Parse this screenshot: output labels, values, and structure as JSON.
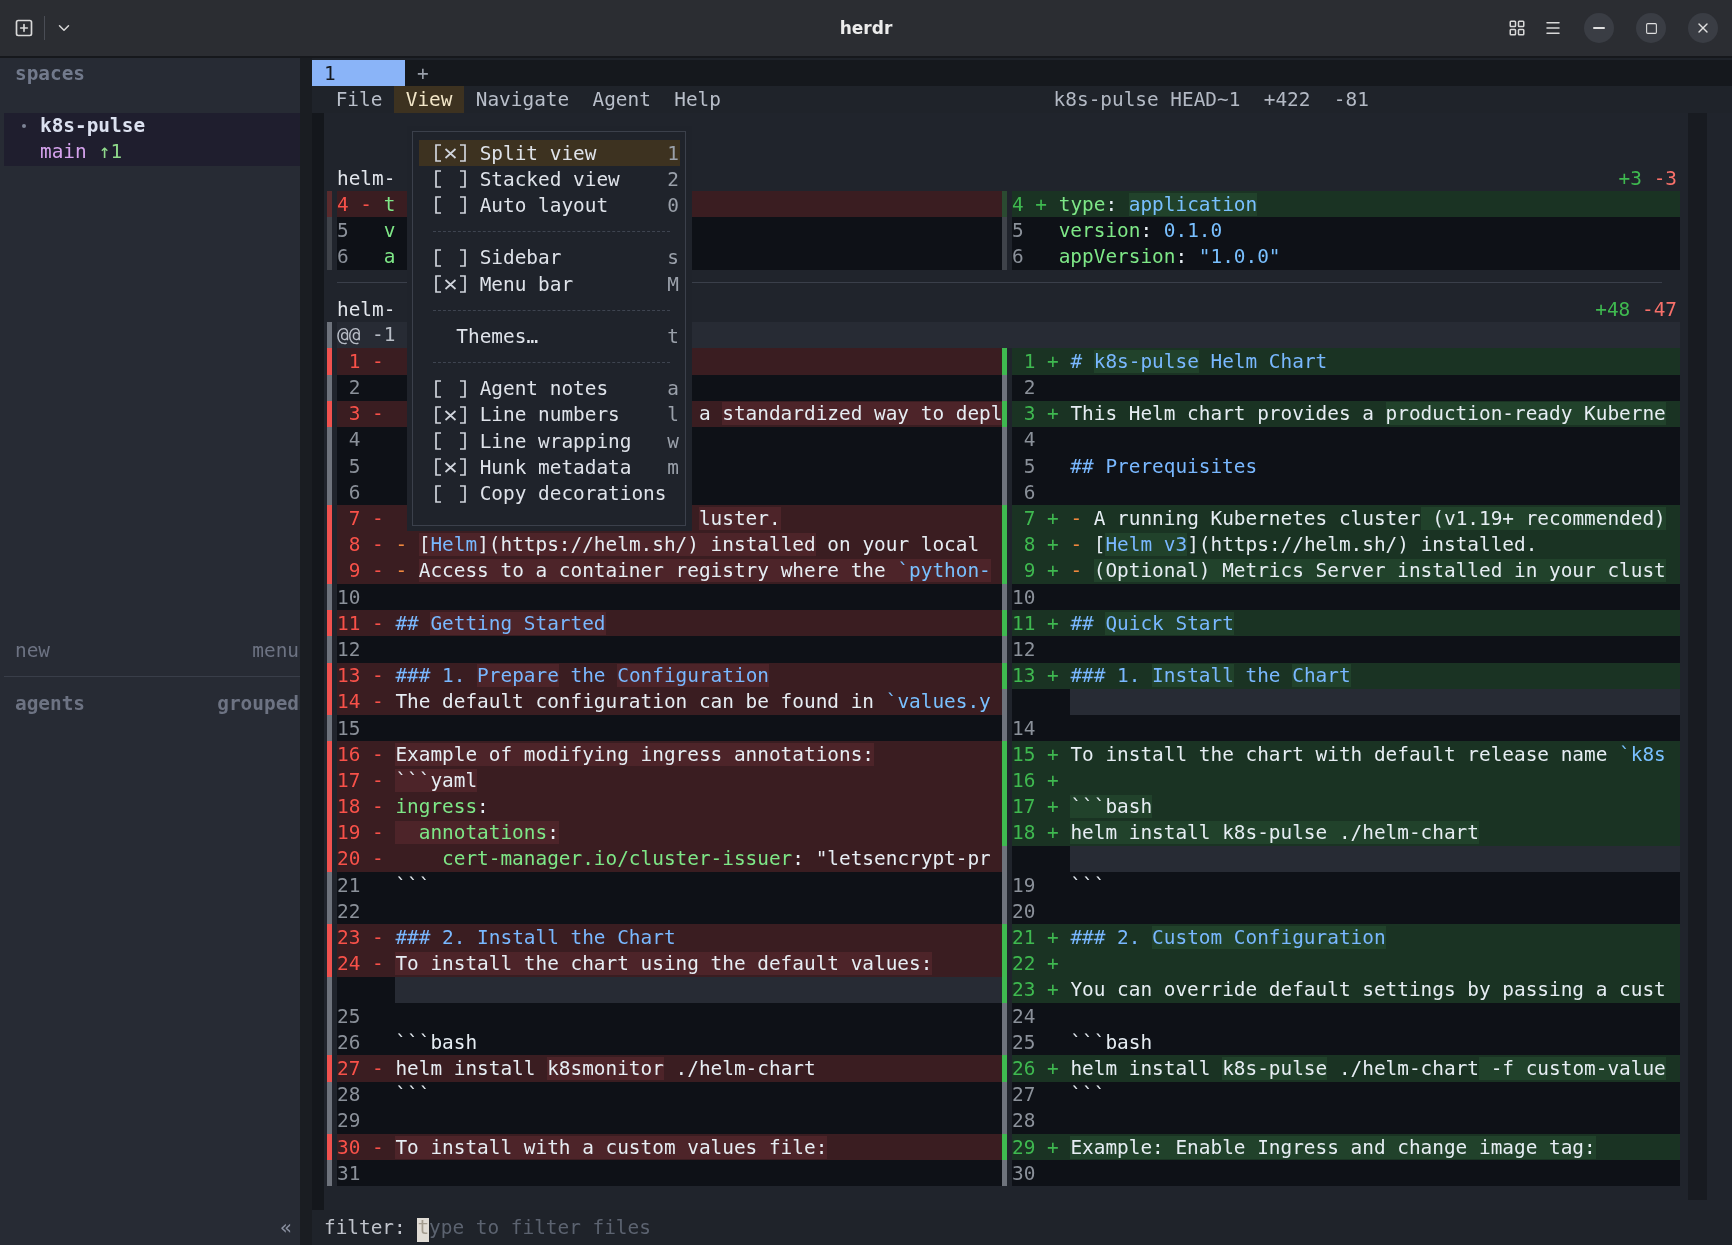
{
  "window": {
    "title": "herdr"
  },
  "sidebar": {
    "heading": "spaces",
    "workspaces": [
      {
        "name": "k8s-pulse",
        "branch": "main",
        "ahead": "↑1",
        "selected": true
      }
    ],
    "new_label": "new",
    "menu_label": "menu",
    "agents_heading": "agents",
    "agents_mode": "grouped",
    "collapse": "«"
  },
  "tabs": [
    {
      "label": "1",
      "selected": true
    }
  ],
  "add_tab": "+",
  "menu_bar": {
    "items": [
      {
        "label": "File",
        "selected": false
      },
      {
        "label": "View",
        "selected": true
      },
      {
        "label": "Navigate",
        "selected": false
      },
      {
        "label": "Agent",
        "selected": false
      },
      {
        "label": "Help",
        "selected": false
      }
    ],
    "status": {
      "ref": "k8s-pulse HEAD~1",
      "added": "+422",
      "removed": "-81"
    }
  },
  "view_menu": [
    {
      "kind": "toggle",
      "checked": true,
      "label": "Split view",
      "key": "1",
      "selected": true
    },
    {
      "kind": "toggle",
      "checked": false,
      "label": "Stacked view",
      "key": "2",
      "selected": false
    },
    {
      "kind": "toggle",
      "checked": false,
      "label": "Auto layout",
      "key": "0",
      "selected": false
    },
    {
      "kind": "separator"
    },
    {
      "kind": "toggle",
      "checked": false,
      "label": "Sidebar",
      "key": "s",
      "selected": false
    },
    {
      "kind": "toggle",
      "checked": true,
      "label": "Menu bar",
      "key": "M",
      "selected": false
    },
    {
      "kind": "separator"
    },
    {
      "kind": "action",
      "label": "Themes…",
      "key": "t",
      "selected": false
    },
    {
      "kind": "separator"
    },
    {
      "kind": "toggle",
      "checked": false,
      "label": "Agent notes",
      "key": "a",
      "selected": false
    },
    {
      "kind": "toggle",
      "checked": true,
      "label": "Line numbers",
      "key": "l",
      "selected": false
    },
    {
      "kind": "toggle",
      "checked": false,
      "label": "Line wrapping",
      "key": "w",
      "selected": false
    },
    {
      "kind": "toggle",
      "checked": true,
      "label": "Hunk metadata",
      "key": "m",
      "selected": false
    },
    {
      "kind": "toggle",
      "checked": false,
      "label": "Copy decorations",
      "selected": false
    }
  ],
  "diff": {
    "files": [
      {
        "name": "helm-",
        "added": "+3",
        "removed": "-3",
        "focused": false,
        "rows": [
          {
            "left": {
              "kind": "removed",
              "number": "4",
              "sign": "-",
              "segments": [
                {
                  "text": "t",
                  "kind": "key",
                  "highlight": false
                }
              ]
            },
            "right": {
              "kind": "added",
              "number": "4",
              "sign": "+",
              "segments": [
                {
                  "text": "type",
                  "kind": "key",
                  "highlight": false
                },
                {
                  "text": ": ",
                  "kind": "plain",
                  "highlight": false
                },
                {
                  "text": "application",
                  "kind": "value",
                  "highlight": true
                }
              ]
            }
          },
          {
            "left": {
              "kind": "context",
              "number": "5",
              "segments": [
                {
                  "text": "v",
                  "kind": "key",
                  "highlight": false
                }
              ]
            },
            "right": {
              "kind": "context",
              "number": "5",
              "segments": [
                {
                  "text": "version",
                  "kind": "key",
                  "highlight": false
                },
                {
                  "text": ": ",
                  "kind": "plain",
                  "highlight": false
                },
                {
                  "text": "0.1.0",
                  "kind": "value",
                  "highlight": false
                }
              ]
            }
          },
          {
            "left": {
              "kind": "context",
              "number": "6",
              "segments": [
                {
                  "text": "a",
                  "kind": "key",
                  "highlight": false
                }
              ]
            },
            "right": {
              "kind": "context",
              "number": "6",
              "segments": [
                {
                  "text": "appVersion",
                  "kind": "key",
                  "highlight": false
                },
                {
                  "text": ": ",
                  "kind": "plain",
                  "highlight": false
                },
                {
                  "text": "\"1.0.0\"",
                  "kind": "value",
                  "highlight": false
                }
              ]
            }
          }
        ]
      },
      {
        "name": "helm-",
        "added": "+48",
        "removed": "-47",
        "focused": true,
        "hunk": "@@ -1",
        "rows": [
          {
            "left": {
              "kind": "removed",
              "number": "1",
              "sign": "-"
            },
            "right": {
              "kind": "added",
              "number": "1",
              "sign": "+",
              "segments": [
                {
                  "text": "# ",
                  "kind": "heading",
                  "highlight": false
                },
                {
                  "text": "k8s-pulse",
                  "kind": "heading",
                  "highlight": true
                },
                {
                  "text": " Helm Chart",
                  "kind": "heading",
                  "highlight": false
                }
              ]
            }
          },
          {
            "left": {
              "kind": "context",
              "number": "2"
            },
            "right": {
              "kind": "context",
              "number": "2"
            }
          },
          {
            "left": {
              "kind": "removed",
              "number": "3",
              "sign": "-",
              "after_menu": [
                {
                  "text": "a ",
                  "kind": "plain",
                  "highlight": false
                },
                {
                  "text": "standardized way to depl",
                  "kind": "plain",
                  "highlight": true
                }
              ]
            },
            "right": {
              "kind": "added",
              "number": "3",
              "sign": "+",
              "segments": [
                {
                  "text": "This Helm chart provides a ",
                  "kind": "plain",
                  "highlight": false
                },
                {
                  "text": "production-ready Kuberne",
                  "kind": "plain",
                  "highlight": true
                }
              ]
            }
          },
          {
            "left": {
              "kind": "context",
              "number": "4"
            },
            "right": {
              "kind": "context",
              "number": "4"
            }
          },
          {
            "left": {
              "kind": "context",
              "number": "5"
            },
            "right": {
              "kind": "context",
              "number": "5",
              "segments": [
                {
                  "text": "## Prerequisites",
                  "kind": "heading",
                  "highlight": false
                }
              ]
            }
          },
          {
            "left": {
              "kind": "context",
              "number": "6"
            },
            "right": {
              "kind": "context",
              "number": "6"
            }
          },
          {
            "left": {
              "kind": "removed",
              "number": "7",
              "sign": "-",
              "after_menu": [
                {
                  "text": "luster.",
                  "kind": "plain",
                  "highlight": true
                }
              ]
            },
            "right": {
              "kind": "added",
              "number": "7",
              "sign": "+",
              "segments": [
                {
                  "text": "- ",
                  "kind": "bullet",
                  "highlight": false
                },
                {
                  "text": "A running Kubernetes cluster",
                  "kind": "plain",
                  "highlight": false
                },
                {
                  "text": " (v1.19+ recommended)",
                  "kind": "plain",
                  "highlight": true
                }
              ]
            }
          },
          {
            "left": {
              "kind": "removed",
              "number": "8",
              "sign": "-",
              "segments": [
                {
                  "text": "- ",
                  "kind": "bullet",
                  "highlight": false
                },
                {
                  "text": "[",
                  "kind": "plain",
                  "highlight": true
                },
                {
                  "text": "Helm",
                  "kind": "link",
                  "highlight": true
                },
                {
                  "text": "](https://helm.sh/) installed",
                  "kind": "plain",
                  "highlight": true
                },
                {
                  "text": " on your local",
                  "kind": "plain",
                  "highlight": false
                }
              ]
            },
            "right": {
              "kind": "added",
              "number": "8",
              "sign": "+",
              "segments": [
                {
                  "text": "- ",
                  "kind": "bullet",
                  "highlight": false
                },
                {
                  "text": "[",
                  "kind": "plain",
                  "highlight": false
                },
                {
                  "text": "Helm v3",
                  "kind": "link",
                  "highlight": true
                },
                {
                  "text": "](https://helm.sh/) installed.",
                  "kind": "plain",
                  "highlight": false
                }
              ]
            }
          },
          {
            "left": {
              "kind": "removed",
              "number": "9",
              "sign": "-",
              "segments": [
                {
                  "text": "- ",
                  "kind": "bullet",
                  "highlight": false
                },
                {
                  "text": "Access to a container registry where the ",
                  "kind": "plain",
                  "highlight": true
                },
                {
                  "text": "`python-",
                  "kind": "value",
                  "highlight": true
                }
              ]
            },
            "right": {
              "kind": "added",
              "number": "9",
              "sign": "+",
              "segments": [
                {
                  "text": "- ",
                  "kind": "bullet",
                  "highlight": false
                },
                {
                  "text": "(Optional) Metrics Server installed in your clust",
                  "kind": "plain",
                  "highlight": true
                }
              ]
            }
          },
          {
            "left": {
              "kind": "context",
              "number": "10"
            },
            "right": {
              "kind": "context",
              "number": "10"
            }
          },
          {
            "left": {
              "kind": "removed",
              "number": "11",
              "sign": "-",
              "segments": [
                {
                  "text": "## ",
                  "kind": "heading",
                  "highlight": false
                },
                {
                  "text": "Getting Started",
                  "kind": "heading",
                  "highlight": true
                }
              ]
            },
            "right": {
              "kind": "added",
              "number": "11",
              "sign": "+",
              "segments": [
                {
                  "text": "## ",
                  "kind": "heading",
                  "highlight": false
                },
                {
                  "text": "Quick Start",
                  "kind": "heading",
                  "highlight": true
                }
              ]
            }
          },
          {
            "left": {
              "kind": "context",
              "number": "12"
            },
            "right": {
              "kind": "context",
              "number": "12"
            }
          },
          {
            "left": {
              "kind": "removed",
              "number": "13",
              "sign": "-",
              "segments": [
                {
                  "text": "### 1. ",
                  "kind": "heading",
                  "highlight": false
                },
                {
                  "text": "Prepare",
                  "kind": "heading",
                  "highlight": true
                },
                {
                  "text": " the ",
                  "kind": "heading",
                  "highlight": false
                },
                {
                  "text": "Configuration",
                  "kind": "heading",
                  "highlight": true
                }
              ]
            },
            "right": {
              "kind": "added",
              "number": "13",
              "sign": "+",
              "segments": [
                {
                  "text": "### 1. ",
                  "kind": "heading",
                  "highlight": false
                },
                {
                  "text": "Install",
                  "kind": "heading",
                  "highlight": true
                },
                {
                  "text": " the ",
                  "kind": "heading",
                  "highlight": false
                },
                {
                  "text": "Chart",
                  "kind": "heading",
                  "highlight": true
                }
              ]
            }
          },
          {
            "left": {
              "kind": "removed",
              "number": "14",
              "sign": "-",
              "segments": [
                {
                  "text": "The default configuration can be found in ",
                  "kind": "plain",
                  "highlight": false
                },
                {
                  "text": "`values.y",
                  "kind": "value",
                  "highlight": false
                }
              ]
            },
            "right": {
              "kind": "filler"
            }
          },
          {
            "left": {
              "kind": "context",
              "number": "15"
            },
            "right": {
              "kind": "context",
              "number": "14"
            }
          },
          {
            "left": {
              "kind": "removed",
              "number": "16",
              "sign": "-",
              "segments": [
                {
                  "text": "Example of modifying ingress annotations:",
                  "kind": "plain",
                  "highlight": true
                }
              ]
            },
            "right": {
              "kind": "added",
              "number": "15",
              "sign": "+",
              "segments": [
                {
                  "text": "To install the chart with default release name ",
                  "kind": "plain",
                  "highlight": false
                },
                {
                  "text": "`k8s",
                  "kind": "value",
                  "highlight": false
                }
              ]
            }
          },
          {
            "left": {
              "kind": "removed",
              "number": "17",
              "sign": "-",
              "segments": [
                {
                  "text": "```yaml",
                  "kind": "plain",
                  "highlight": true
                }
              ]
            },
            "right": {
              "kind": "added",
              "number": "16",
              "sign": "+"
            }
          },
          {
            "left": {
              "kind": "removed",
              "number": "18",
              "sign": "-",
              "segments": [
                {
                  "text": "ingress",
                  "kind": "key",
                  "highlight": false
                },
                {
                  "text": ":",
                  "kind": "plain",
                  "highlight": false
                }
              ]
            },
            "right": {
              "kind": "added",
              "number": "17",
              "sign": "+",
              "segments": [
                {
                  "text": "```bash",
                  "kind": "plain",
                  "highlight": true
                }
              ]
            }
          },
          {
            "left": {
              "kind": "removed",
              "number": "19",
              "sign": "-",
              "segments": [
                {
                  "text": "  annotations",
                  "kind": "key",
                  "highlight": true
                },
                {
                  "text": ":",
                  "kind": "plain",
                  "highlight": true
                }
              ]
            },
            "right": {
              "kind": "added",
              "number": "18",
              "sign": "+",
              "segments": [
                {
                  "text": "helm install k8s-pulse ./helm-chart",
                  "kind": "plain",
                  "highlight": true
                }
              ]
            }
          },
          {
            "left": {
              "kind": "removed",
              "number": "20",
              "sign": "-",
              "segments": [
                {
                  "text": "    cert-manager.io/cluster-issuer",
                  "kind": "key",
                  "highlight": false
                },
                {
                  "text": ": ",
                  "kind": "plain",
                  "highlight": false
                },
                {
                  "text": "\"letsencrypt-pr",
                  "kind": "plain",
                  "highlight": false
                }
              ]
            },
            "right": {
              "kind": "filler"
            }
          },
          {
            "left": {
              "kind": "context",
              "number": "21",
              "segments": [
                {
                  "text": "```",
                  "kind": "plain",
                  "highlight": false
                }
              ]
            },
            "right": {
              "kind": "context",
              "number": "19",
              "segments": [
                {
                  "text": "```",
                  "kind": "plain",
                  "highlight": false
                }
              ]
            }
          },
          {
            "left": {
              "kind": "context",
              "number": "22"
            },
            "right": {
              "kind": "context",
              "number": "20"
            }
          },
          {
            "left": {
              "kind": "removed",
              "number": "23",
              "sign": "-",
              "segments": [
                {
                  "text": "### 2. ",
                  "kind": "heading",
                  "highlight": false
                },
                {
                  "text": "Install the Chart",
                  "kind": "heading",
                  "highlight": false
                }
              ]
            },
            "right": {
              "kind": "added",
              "number": "21",
              "sign": "+",
              "segments": [
                {
                  "text": "### 2. ",
                  "kind": "heading",
                  "highlight": false
                },
                {
                  "text": "Custom Configuration",
                  "kind": "heading",
                  "highlight": true
                }
              ]
            }
          },
          {
            "left": {
              "kind": "removed",
              "number": "24",
              "sign": "-",
              "segments": [
                {
                  "text": "To install the chart using the default values:",
                  "kind": "plain",
                  "highlight": true
                }
              ]
            },
            "right": {
              "kind": "added",
              "number": "22",
              "sign": "+"
            }
          },
          {
            "left": {
              "kind": "filler"
            },
            "right": {
              "kind": "added",
              "number": "23",
              "sign": "+",
              "segments": [
                {
                  "text": "You can override default settings by passing a cust",
                  "kind": "plain",
                  "highlight": false
                }
              ]
            }
          },
          {
            "left": {
              "kind": "context",
              "number": "25"
            },
            "right": {
              "kind": "context",
              "number": "24"
            }
          },
          {
            "left": {
              "kind": "context",
              "number": "26",
              "segments": [
                {
                  "text": "```bash",
                  "kind": "plain",
                  "highlight": false
                }
              ]
            },
            "right": {
              "kind": "context",
              "number": "25",
              "segments": [
                {
                  "text": "```bash",
                  "kind": "plain",
                  "highlight": false
                }
              ]
            }
          },
          {
            "left": {
              "kind": "removed",
              "number": "27",
              "sign": "-",
              "segments": [
                {
                  "text": "helm install ",
                  "kind": "plain",
                  "highlight": false
                },
                {
                  "text": "k8smonitor",
                  "kind": "plain",
                  "highlight": true
                },
                {
                  "text": " ./helm-chart",
                  "kind": "plain",
                  "highlight": false
                }
              ]
            },
            "right": {
              "kind": "added",
              "number": "26",
              "sign": "+",
              "segments": [
                {
                  "text": "helm install ",
                  "kind": "plain",
                  "highlight": false
                },
                {
                  "text": "k8s-pulse",
                  "kind": "plain",
                  "highlight": true
                },
                {
                  "text": " ./helm-chart",
                  "kind": "plain",
                  "highlight": false
                },
                {
                  "text": " -f custom-value",
                  "kind": "plain",
                  "highlight": true
                }
              ]
            }
          },
          {
            "left": {
              "kind": "context",
              "number": "28",
              "segments": [
                {
                  "text": "```",
                  "kind": "plain",
                  "highlight": false
                }
              ]
            },
            "right": {
              "kind": "context",
              "number": "27",
              "segments": [
                {
                  "text": "```",
                  "kind": "plain",
                  "highlight": false
                }
              ]
            }
          },
          {
            "left": {
              "kind": "context",
              "number": "29"
            },
            "right": {
              "kind": "context",
              "number": "28"
            }
          },
          {
            "left": {
              "kind": "removed",
              "number": "30",
              "sign": "-",
              "segments": [
                {
                  "text": "To install with a custom values file:",
                  "kind": "plain",
                  "highlight": true
                }
              ]
            },
            "right": {
              "kind": "added",
              "number": "29",
              "sign": "+",
              "segments": [
                {
                  "text": "Example: Enable Ingress and change image tag:",
                  "kind": "plain",
                  "highlight": true
                }
              ]
            }
          },
          {
            "left": {
              "kind": "context",
              "number": "31"
            },
            "right": {
              "kind": "context",
              "number": "30"
            }
          }
        ]
      }
    ]
  },
  "filter": {
    "label": "filter:",
    "placeholder": "type to filter files"
  }
}
